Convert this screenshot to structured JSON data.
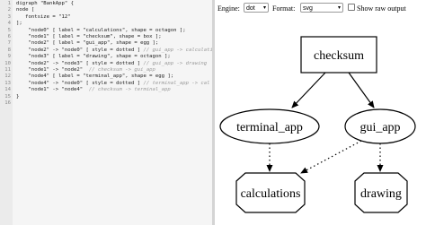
{
  "editor": {
    "lines": [
      {
        "num": "1",
        "code": "digraph \"BankApp\" {"
      },
      {
        "num": "2",
        "code": "node ["
      },
      {
        "num": "3",
        "code": "   fontsize = \"12\""
      },
      {
        "num": "4",
        "code": "];"
      },
      {
        "num": "5",
        "code": "    \"node0\" [ label = \"calculations\", shape = octagon ];"
      },
      {
        "num": "6",
        "code": "    \"node1\" [ label = \"checksum\", shape = box ];"
      },
      {
        "num": "7",
        "code": "    \"node2\" [ label = \"gui_app\", shape = egg ];"
      },
      {
        "num": "8",
        "code": "    \"node2\" -> \"node0\" [ style = dotted ]",
        "comment": " // gui_app -> calculations"
      },
      {
        "num": "9",
        "code": "    \"node3\" [ label = \"drawing\", shape = octagon ];"
      },
      {
        "num": "10",
        "code": "    \"node2\" -> \"node3\" [ style = dotted ]",
        "comment": " // gui_app -> drawing"
      },
      {
        "num": "11",
        "code": "    \"node1\" -> \"node2\"",
        "comment": "  // checksum -> gui_app"
      },
      {
        "num": "12",
        "code": "    \"node4\" [ label = \"terminal_app\", shape = egg ];"
      },
      {
        "num": "13",
        "code": "    \"node4\" -> \"node0\" [ style = dotted ]",
        "comment": " // terminal_app -> cal"
      },
      {
        "num": "14",
        "code": "    \"node1\" -> \"node4\"",
        "comment": "  // checksum -> terminal_app"
      },
      {
        "num": "15",
        "code": "}"
      },
      {
        "num": "16",
        "code": ""
      }
    ]
  },
  "toolbar": {
    "engine_label": "Engine:",
    "engine_value": "dot",
    "format_label": "Format:",
    "format_value": "svg",
    "raw_output_label": "Show raw output",
    "raw_output_checked": false
  },
  "graph": {
    "nodes": {
      "checksum": "checksum",
      "terminal_app": "terminal_app",
      "gui_app": "gui_app",
      "calculations": "calculations",
      "drawing": "drawing"
    }
  }
}
